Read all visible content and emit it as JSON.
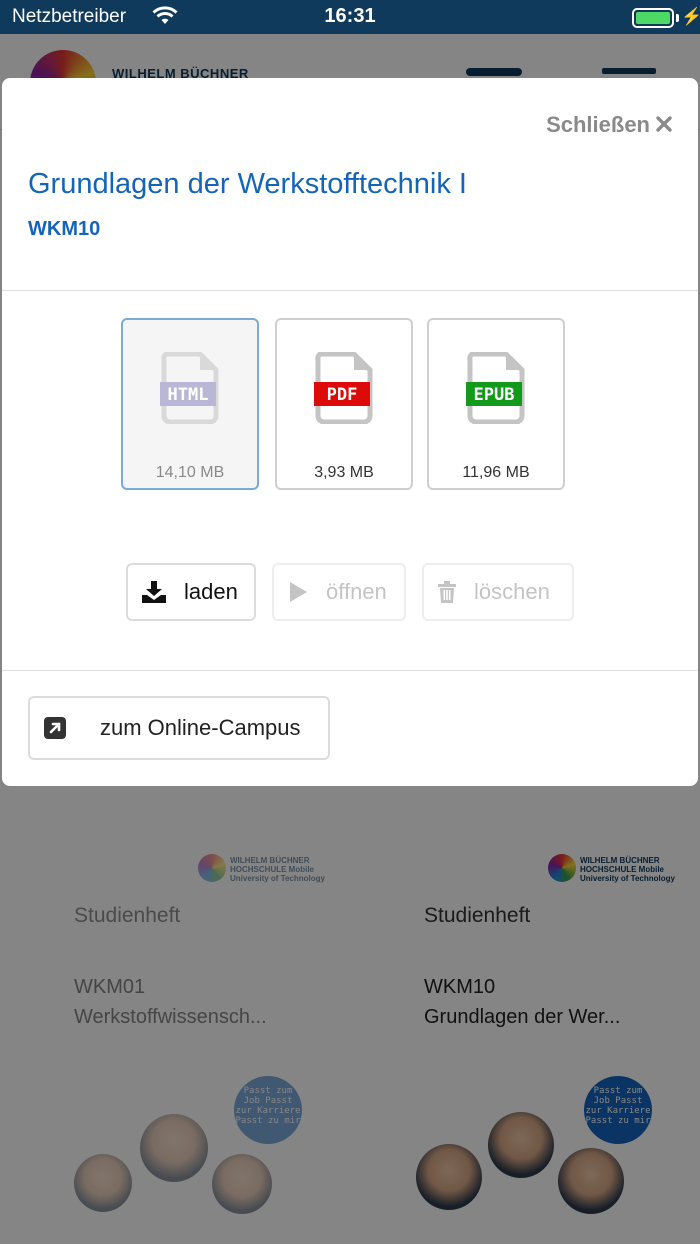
{
  "status_bar": {
    "carrier": "Netzbetreiber",
    "time": "16:31",
    "battery_level": 1.0
  },
  "background": {
    "header_logo_text": "WILHELM BÜCHNER",
    "mini_logo_text": "WILHELM BÜCHNER HOCHSCHULE Mobile University of Technology",
    "cards": [
      {
        "heft": "Studienheft",
        "code": "WKM01",
        "title": "Werkstoffwissensch...",
        "bubble": "Passt zum Job Passt zur Karriere Passt zu mir"
      },
      {
        "heft": "Studienheft",
        "code": "WKM10",
        "title": "Grundlagen der Wer...",
        "bubble": "Passt zum Job Passt zur Karriere Passt zu mir"
      }
    ]
  },
  "modal": {
    "close_label": "Schließen",
    "close_icon": "close-icon",
    "title": "Grundlagen der Werkstofftechnik I",
    "code": "WKM10",
    "formats": [
      {
        "label": "HTML",
        "size": "14,10 MB",
        "color": "#b9b6d6",
        "selected": true
      },
      {
        "label": "PDF",
        "size": "3,93 MB",
        "color": "#dd0a0a",
        "selected": false
      },
      {
        "label": "EPUB",
        "size": "11,96 MB",
        "color": "#149a1a",
        "selected": false
      }
    ],
    "actions": {
      "load": "laden",
      "open": "öffnen",
      "delete": "löschen"
    },
    "campus_button": "zum Online-Campus"
  },
  "colors": {
    "accent": "#1565b5",
    "status_bar": "#0f3a5c",
    "selected_border": "#7aaad6"
  }
}
